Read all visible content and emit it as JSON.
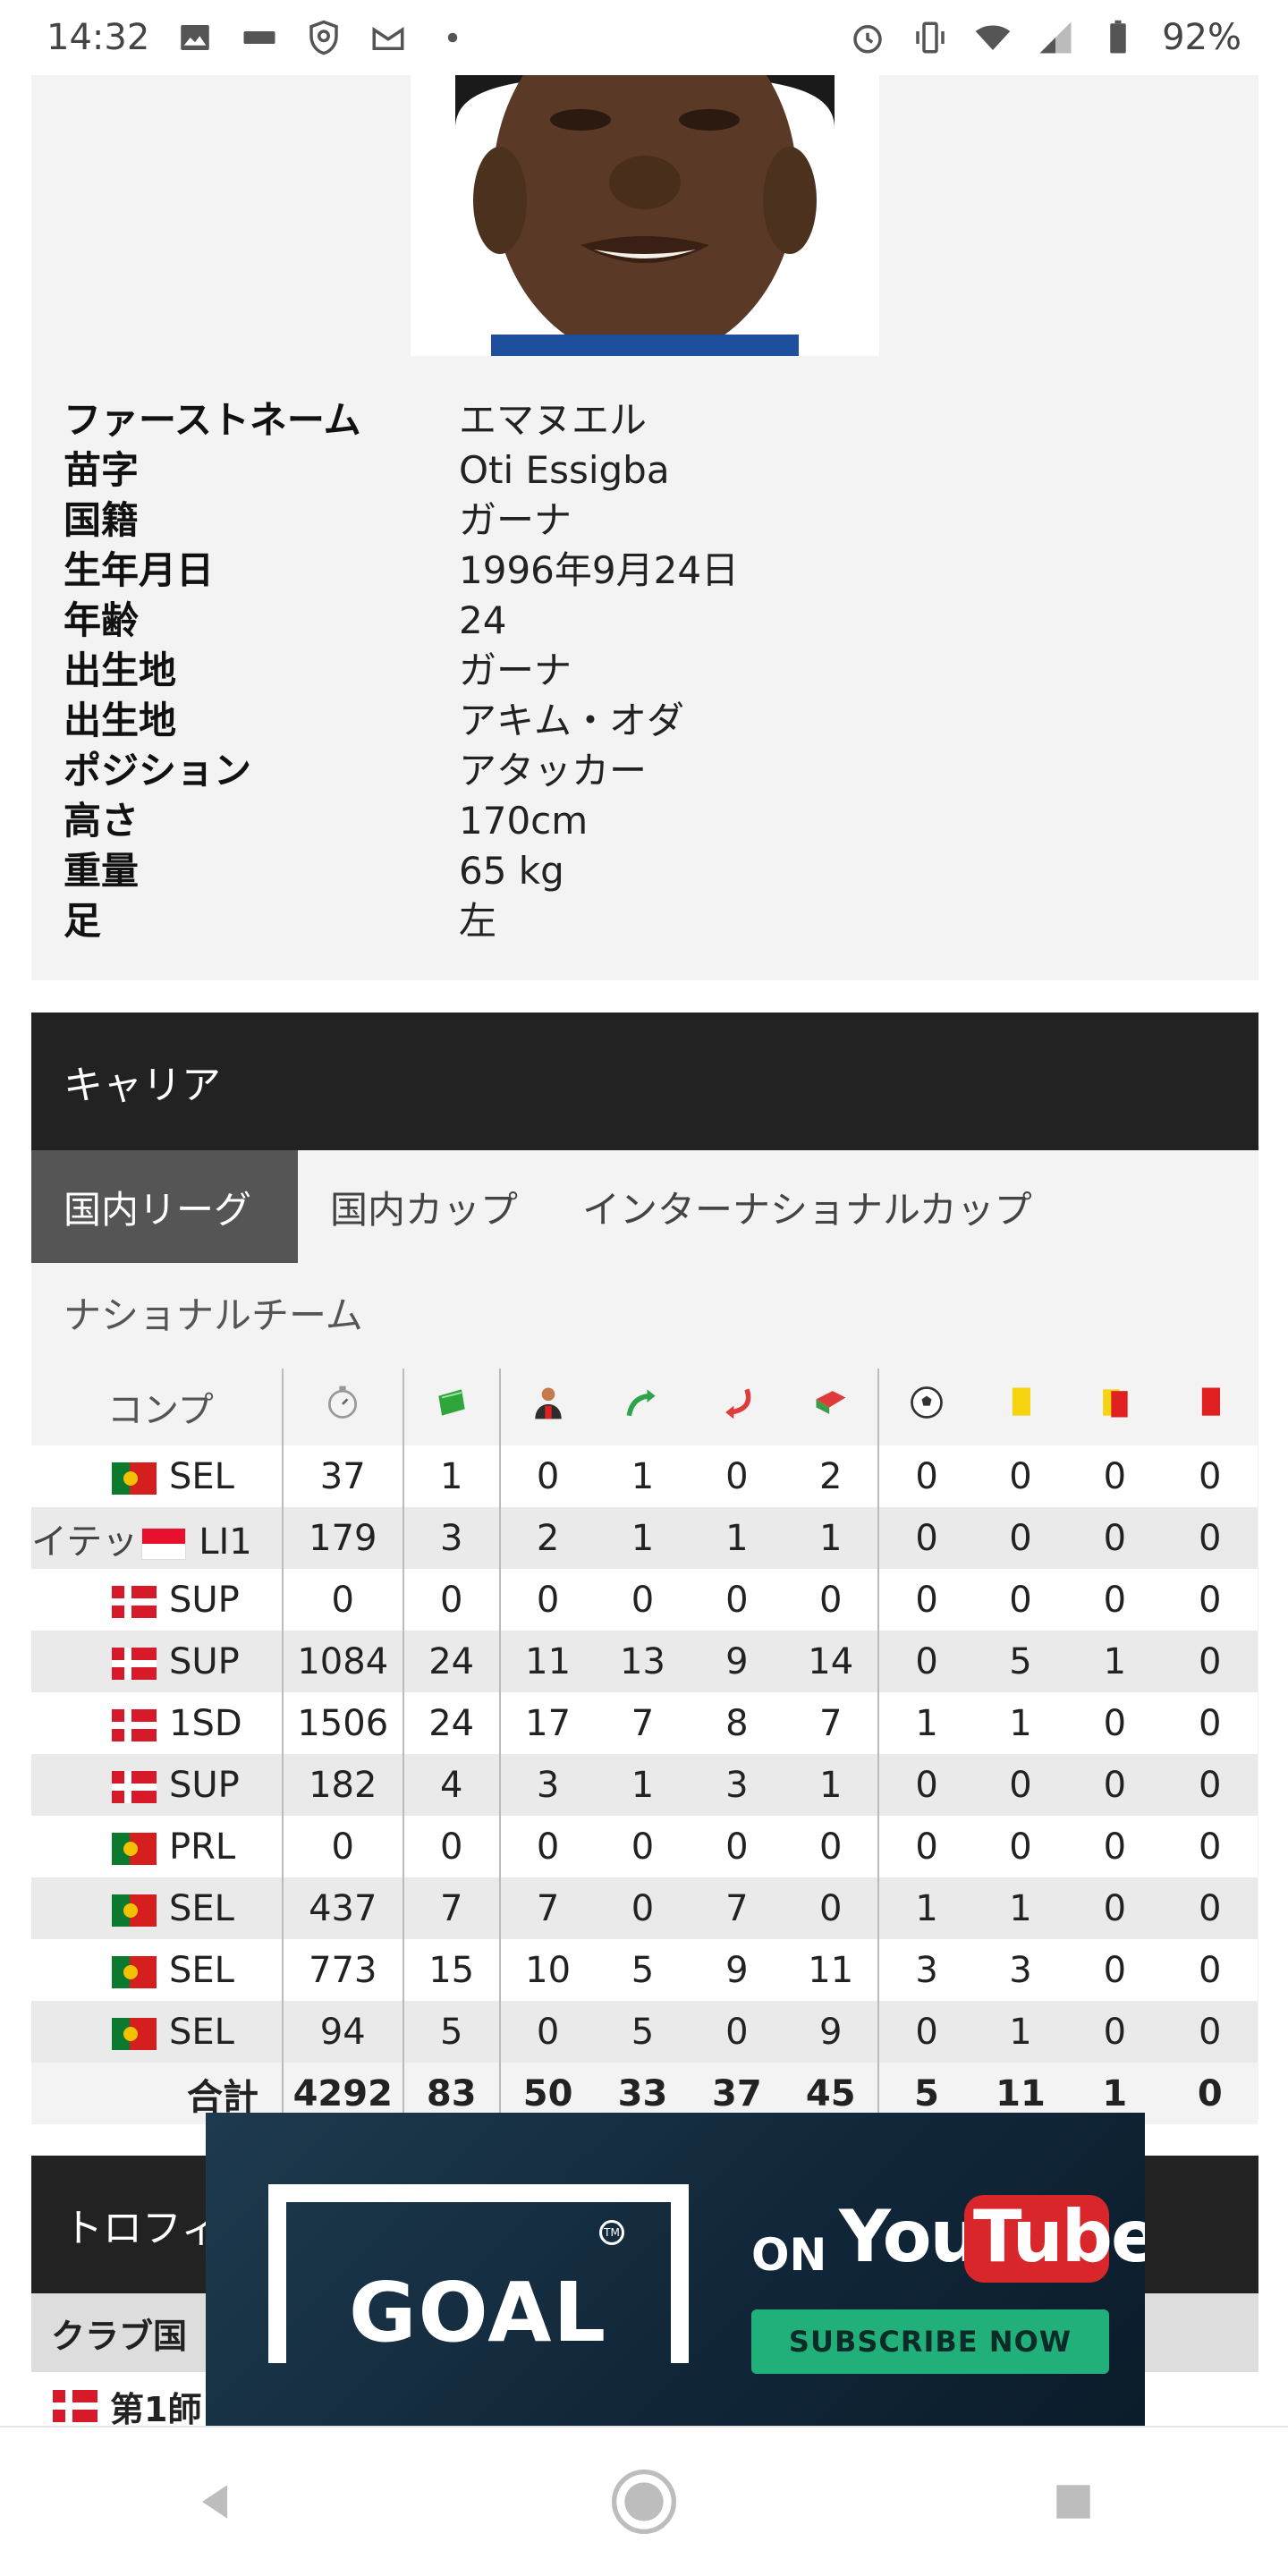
{
  "status_bar": {
    "time": "14:32",
    "battery": "92%",
    "left_icons": [
      "image-icon",
      "app-icon",
      "shield-icon",
      "mail-icon",
      "dot-icon"
    ],
    "right_icons": [
      "alarm-icon",
      "vibrate-icon",
      "wifi-icon",
      "signal-icon",
      "battery-icon"
    ]
  },
  "profile": {
    "rows": [
      {
        "label": "ファーストネーム",
        "value": "エマヌエル"
      },
      {
        "label": "苗字",
        "value": "Oti Essigba"
      },
      {
        "label": "国籍",
        "value": "ガーナ"
      },
      {
        "label": "生年月日",
        "value": "1996年9月24日"
      },
      {
        "label": "年齢",
        "value": "24"
      },
      {
        "label": "出生地",
        "value": "ガーナ"
      },
      {
        "label": "出生地",
        "value": "アキム・オダ"
      },
      {
        "label": "ポジション",
        "value": "アタッカー"
      },
      {
        "label": "高さ",
        "value": "170cm"
      },
      {
        "label": "重量",
        "value": "65 kg"
      },
      {
        "label": "足",
        "value": "左"
      }
    ]
  },
  "career": {
    "title": "キャリア",
    "tabs": [
      "国内リーグ",
      "国内カップ",
      "インターナショナルカップ"
    ],
    "subtab": "ナショナルチーム",
    "comp_header": "コンプ",
    "column_icons": [
      "stopwatch-icon",
      "pitch-icon",
      "player-icon",
      "assist-arrow-icon",
      "sub-out-arrow-icon",
      "sub-in-icon",
      "ball-icon",
      "yellow-card-icon",
      "second-yellow-icon",
      "red-card-icon"
    ],
    "rows": [
      {
        "prefix": "",
        "flag": "pt",
        "comp": "SEL",
        "values": [
          "37",
          "1",
          "0",
          "1",
          "0",
          "2",
          "0",
          "0",
          "0",
          "0"
        ]
      },
      {
        "prefix": "イテッ",
        "flag": "mc",
        "comp": "LI1",
        "values": [
          "179",
          "3",
          "2",
          "1",
          "1",
          "1",
          "0",
          "0",
          "0",
          "0"
        ]
      },
      {
        "prefix": "",
        "flag": "dk",
        "comp": "SUP",
        "values": [
          "0",
          "0",
          "0",
          "0",
          "0",
          "0",
          "0",
          "0",
          "0",
          "0"
        ]
      },
      {
        "prefix": "",
        "flag": "dk",
        "comp": "SUP",
        "values": [
          "1084",
          "24",
          "11",
          "13",
          "9",
          "14",
          "0",
          "5",
          "1",
          "0"
        ]
      },
      {
        "prefix": "",
        "flag": "dk",
        "comp": "1SD",
        "values": [
          "1506",
          "24",
          "17",
          "7",
          "8",
          "7",
          "1",
          "1",
          "0",
          "0"
        ]
      },
      {
        "prefix": "",
        "flag": "dk",
        "comp": "SUP",
        "values": [
          "182",
          "4",
          "3",
          "1",
          "3",
          "1",
          "0",
          "0",
          "0",
          "0"
        ]
      },
      {
        "prefix": "",
        "flag": "pt",
        "comp": "PRL",
        "values": [
          "0",
          "0",
          "0",
          "0",
          "0",
          "0",
          "0",
          "0",
          "0",
          "0"
        ]
      },
      {
        "prefix": "",
        "flag": "pt",
        "comp": "SEL",
        "values": [
          "437",
          "7",
          "7",
          "0",
          "7",
          "0",
          "1",
          "1",
          "0",
          "0"
        ]
      },
      {
        "prefix": "",
        "flag": "pt",
        "comp": "SEL",
        "values": [
          "773",
          "15",
          "10",
          "5",
          "9",
          "11",
          "3",
          "3",
          "0",
          "0"
        ]
      },
      {
        "prefix": "",
        "flag": "pt",
        "comp": "SEL",
        "values": [
          "94",
          "5",
          "0",
          "5",
          "0",
          "9",
          "0",
          "1",
          "0",
          "0"
        ]
      }
    ],
    "total_label": "合計",
    "totals": [
      "4292",
      "83",
      "50",
      "33",
      "37",
      "45",
      "5",
      "11",
      "1",
      "0"
    ]
  },
  "trophies": {
    "title": "トロフィ",
    "subheader": "クラブ国",
    "row_label": "第1師"
  },
  "ad": {
    "brand": "GOAL",
    "on": "ON",
    "you": "You",
    "tube": "Tube",
    "cta": "SUBSCRIBE NOW"
  },
  "navbar": {
    "icons": [
      "back-icon",
      "home-icon",
      "recents-icon"
    ]
  }
}
